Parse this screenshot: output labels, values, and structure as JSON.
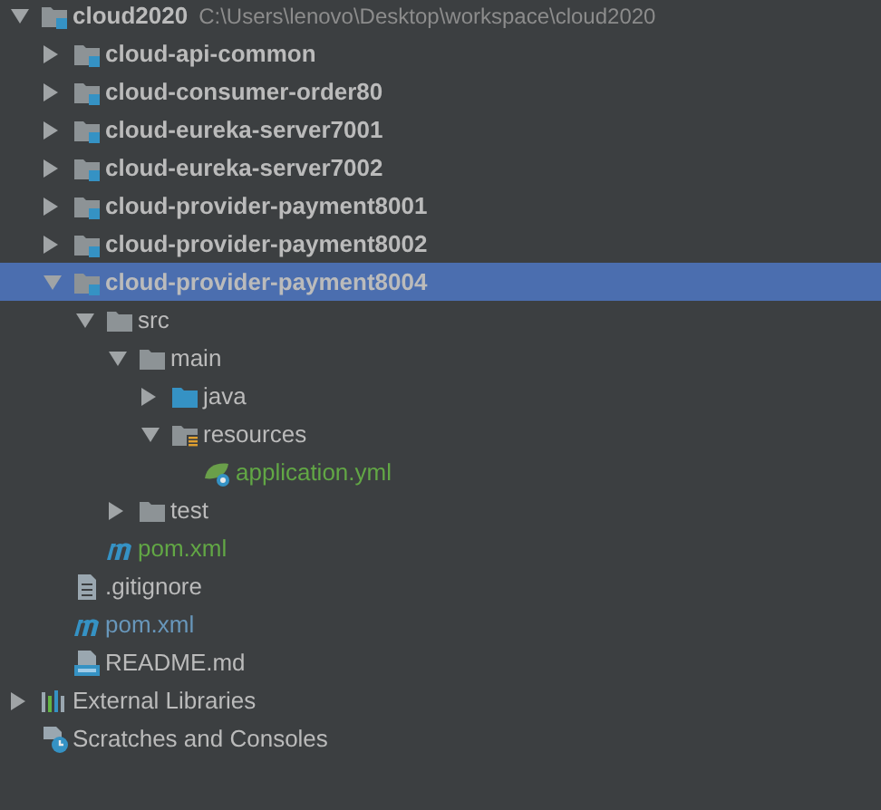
{
  "tree": [
    {
      "kind": "module",
      "label": "cloud2020",
      "path": "C:\\Users\\lenovo\\Desktop\\workspace\\cloud2020",
      "expanded": true,
      "selected": false,
      "children": [
        {
          "kind": "module",
          "label": "cloud-api-common",
          "expanded": false,
          "selected": false
        },
        {
          "kind": "module",
          "label": "cloud-consumer-order80",
          "expanded": false,
          "selected": false
        },
        {
          "kind": "module",
          "label": "cloud-eureka-server7001",
          "expanded": false,
          "selected": false
        },
        {
          "kind": "module",
          "label": "cloud-eureka-server7002",
          "expanded": false,
          "selected": false
        },
        {
          "kind": "module",
          "label": "cloud-provider-payment8001",
          "expanded": false,
          "selected": false
        },
        {
          "kind": "module",
          "label": "cloud-provider-payment8002",
          "expanded": false,
          "selected": false
        },
        {
          "kind": "module",
          "label": "cloud-provider-payment8004",
          "expanded": true,
          "selected": true,
          "children": [
            {
              "kind": "folder",
              "label": "src",
              "expanded": true,
              "selected": false,
              "children": [
                {
                  "kind": "folder",
                  "label": "main",
                  "expanded": true,
                  "selected": false,
                  "children": [
                    {
                      "kind": "source-folder",
                      "label": "java",
                      "expanded": false,
                      "selected": false
                    },
                    {
                      "kind": "resource-folder",
                      "label": "resources",
                      "expanded": true,
                      "selected": false,
                      "children": [
                        {
                          "kind": "yml",
                          "label": "application.yml",
                          "color": "#62a745",
                          "selected": false
                        }
                      ]
                    }
                  ]
                },
                {
                  "kind": "folder",
                  "label": "test",
                  "expanded": false,
                  "selected": false
                }
              ]
            },
            {
              "kind": "maven",
              "label": "pom.xml",
              "color": "#62a745",
              "selected": false
            }
          ]
        },
        {
          "kind": "file",
          "label": ".gitignore",
          "selected": false
        },
        {
          "kind": "maven",
          "label": "pom.xml",
          "color": "#6897bb",
          "selected": false
        },
        {
          "kind": "markdown",
          "label": "README.md",
          "selected": false
        }
      ]
    },
    {
      "kind": "libraries",
      "label": "External Libraries",
      "expanded": false,
      "selected": false
    },
    {
      "kind": "scratches",
      "label": "Scratches and Consoles",
      "selected": false
    }
  ]
}
